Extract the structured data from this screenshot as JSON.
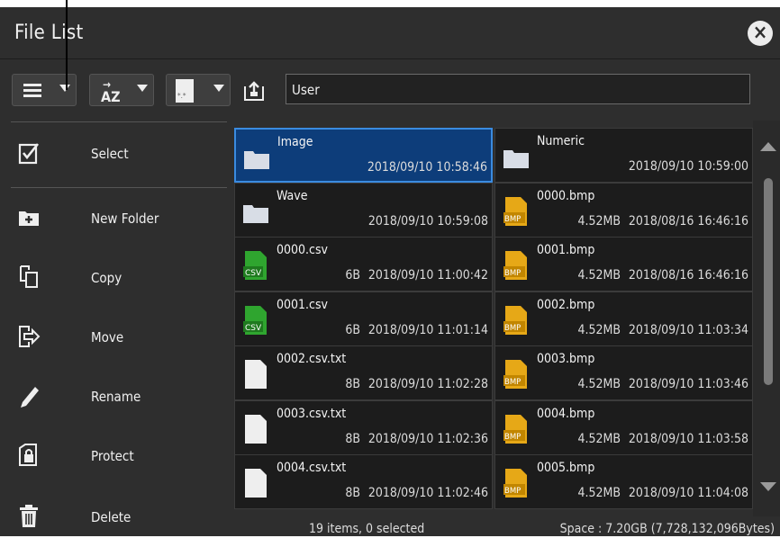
{
  "window": {
    "title": "File List"
  },
  "toolbar": {
    "path": "User"
  },
  "sidebar": {
    "items": [
      {
        "label": "Select",
        "icon": "checkbox-icon"
      },
      {
        "label": "New Folder",
        "icon": "new-folder-icon"
      },
      {
        "label": "Copy",
        "icon": "copy-icon"
      },
      {
        "label": "Move",
        "icon": "move-icon"
      },
      {
        "label": "Rename",
        "icon": "pencil-icon"
      },
      {
        "label": "Protect",
        "icon": "lock-file-icon"
      },
      {
        "label": "Delete",
        "icon": "trash-icon"
      }
    ]
  },
  "files": {
    "left": [
      {
        "name": "Image",
        "size": "",
        "date": "2018/09/10 10:58:46",
        "type": "folder",
        "selected": true
      },
      {
        "name": "Wave",
        "size": "",
        "date": "2018/09/10 10:59:08",
        "type": "folder"
      },
      {
        "name": "0000.csv",
        "size": "6B",
        "date": "2018/09/10 11:00:42",
        "type": "csv"
      },
      {
        "name": "0001.csv",
        "size": "6B",
        "date": "2018/09/10 11:01:14",
        "type": "csv"
      },
      {
        "name": "0002.csv.txt",
        "size": "8B",
        "date": "2018/09/10 11:02:28",
        "type": "txt"
      },
      {
        "name": "0003.csv.txt",
        "size": "8B",
        "date": "2018/09/10 11:02:36",
        "type": "txt"
      },
      {
        "name": "0004.csv.txt",
        "size": "8B",
        "date": "2018/09/10 11:02:46",
        "type": "txt"
      }
    ],
    "right": [
      {
        "name": "Numeric",
        "size": "",
        "date": "2018/09/10 10:59:00",
        "type": "folder"
      },
      {
        "name": "0000.bmp",
        "size": "4.52MB",
        "date": "2018/08/16 16:46:16",
        "type": "bmp"
      },
      {
        "name": "0001.bmp",
        "size": "4.52MB",
        "date": "2018/08/16 16:46:16",
        "type": "bmp"
      },
      {
        "name": "0002.bmp",
        "size": "4.52MB",
        "date": "2018/09/10 11:03:34",
        "type": "bmp"
      },
      {
        "name": "0003.bmp",
        "size": "4.52MB",
        "date": "2018/09/10 11:03:46",
        "type": "bmp"
      },
      {
        "name": "0004.bmp",
        "size": "4.52MB",
        "date": "2018/09/10 11:03:58",
        "type": "bmp"
      },
      {
        "name": "0005.bmp",
        "size": "4.52MB",
        "date": "2018/09/10 11:04:08",
        "type": "bmp"
      }
    ]
  },
  "status": {
    "count": "19 items, 0 selected",
    "space": "Space : 7.20GB (7,728,132,096Bytes)"
  },
  "colors": {
    "selected_bg": "#0d3d7a",
    "selected_border": "#3a8be0",
    "csv_icon": "#2fa52f",
    "bmp_icon": "#e6a817"
  }
}
